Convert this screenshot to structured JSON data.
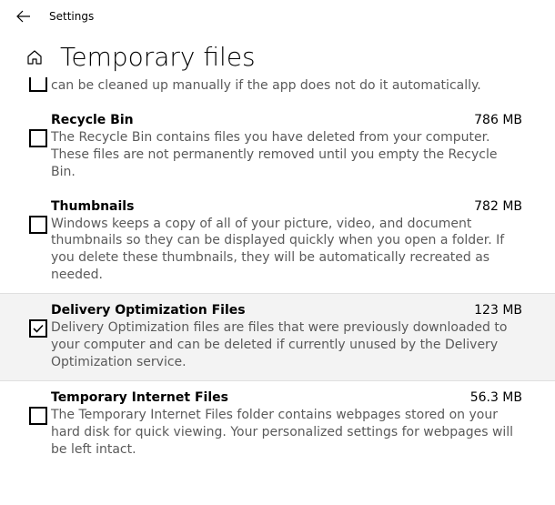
{
  "app_title": "Settings",
  "page_title": "Temporary files",
  "items": [
    {
      "title": "",
      "size": "",
      "desc": "can be cleaned up manually if the app does not do it automatically.",
      "checked": false,
      "partial": true
    },
    {
      "title": "Recycle Bin",
      "size": "786 MB",
      "desc": "The Recycle Bin contains files you have deleted from your computer. These files are not permanently removed until you empty the Recycle Bin.",
      "checked": false,
      "selected": false
    },
    {
      "title": "Thumbnails",
      "size": "782 MB",
      "desc": "Windows keeps a copy of all of your picture, video, and document thumbnails so they can be displayed quickly when you open a folder. If you delete these thumbnails, they will be automatically recreated as needed.",
      "checked": false,
      "selected": false
    },
    {
      "title": "Delivery Optimization Files",
      "size": "123 MB",
      "desc": "Delivery Optimization files are files that were previously downloaded to your computer and can be deleted if currently unused by the Delivery Optimization service.",
      "checked": true,
      "selected": true
    },
    {
      "title": "Temporary Internet Files",
      "size": "56.3 MB",
      "desc": "The Temporary Internet Files folder contains webpages stored on your hard disk for quick viewing. Your personalized settings for webpages will be left intact.",
      "checked": false,
      "selected": false
    }
  ]
}
